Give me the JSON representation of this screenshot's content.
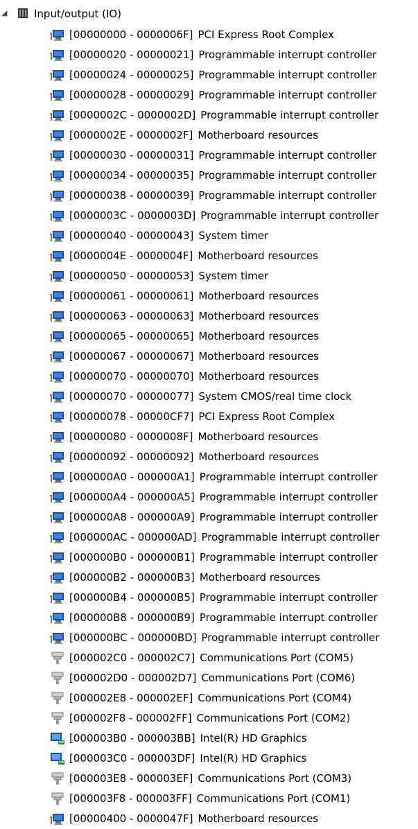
{
  "tree": {
    "root_label": "Input/output (IO)",
    "root_icon": "io-category-icon",
    "items": [
      {
        "range": "[00000000 - 0000006F]",
        "name": "PCI Express Root Complex",
        "icon": "system-device-icon"
      },
      {
        "range": "[00000020 - 00000021]",
        "name": "Programmable interrupt controller",
        "icon": "system-device-icon"
      },
      {
        "range": "[00000024 - 00000025]",
        "name": "Programmable interrupt controller",
        "icon": "system-device-icon"
      },
      {
        "range": "[00000028 - 00000029]",
        "name": "Programmable interrupt controller",
        "icon": "system-device-icon"
      },
      {
        "range": "[0000002C - 0000002D]",
        "name": "Programmable interrupt controller",
        "icon": "system-device-icon"
      },
      {
        "range": "[0000002E - 0000002F]",
        "name": "Motherboard resources",
        "icon": "system-device-icon"
      },
      {
        "range": "[00000030 - 00000031]",
        "name": "Programmable interrupt controller",
        "icon": "system-device-icon"
      },
      {
        "range": "[00000034 - 00000035]",
        "name": "Programmable interrupt controller",
        "icon": "system-device-icon"
      },
      {
        "range": "[00000038 - 00000039]",
        "name": "Programmable interrupt controller",
        "icon": "system-device-icon"
      },
      {
        "range": "[0000003C - 0000003D]",
        "name": "Programmable interrupt controller",
        "icon": "system-device-icon"
      },
      {
        "range": "[00000040 - 00000043]",
        "name": "System timer",
        "icon": "system-device-icon"
      },
      {
        "range": "[0000004E - 0000004F]",
        "name": "Motherboard resources",
        "icon": "system-device-icon"
      },
      {
        "range": "[00000050 - 00000053]",
        "name": "System timer",
        "icon": "system-device-icon"
      },
      {
        "range": "[00000061 - 00000061]",
        "name": "Motherboard resources",
        "icon": "system-device-icon"
      },
      {
        "range": "[00000063 - 00000063]",
        "name": "Motherboard resources",
        "icon": "system-device-icon"
      },
      {
        "range": "[00000065 - 00000065]",
        "name": "Motherboard resources",
        "icon": "system-device-icon"
      },
      {
        "range": "[00000067 - 00000067]",
        "name": "Motherboard resources",
        "icon": "system-device-icon"
      },
      {
        "range": "[00000070 - 00000070]",
        "name": "Motherboard resources",
        "icon": "system-device-icon"
      },
      {
        "range": "[00000070 - 00000077]",
        "name": "System CMOS/real time clock",
        "icon": "system-device-icon"
      },
      {
        "range": "[00000078 - 00000CF7]",
        "name": "PCI Express Root Complex",
        "icon": "system-device-icon"
      },
      {
        "range": "[00000080 - 0000008F]",
        "name": "Motherboard resources",
        "icon": "system-device-icon"
      },
      {
        "range": "[00000092 - 00000092]",
        "name": "Motherboard resources",
        "icon": "system-device-icon"
      },
      {
        "range": "[000000A0 - 000000A1]",
        "name": "Programmable interrupt controller",
        "icon": "system-device-icon"
      },
      {
        "range": "[000000A4 - 000000A5]",
        "name": "Programmable interrupt controller",
        "icon": "system-device-icon"
      },
      {
        "range": "[000000A8 - 000000A9]",
        "name": "Programmable interrupt controller",
        "icon": "system-device-icon"
      },
      {
        "range": "[000000AC - 000000AD]",
        "name": "Programmable interrupt controller",
        "icon": "system-device-icon"
      },
      {
        "range": "[000000B0 - 000000B1]",
        "name": "Programmable interrupt controller",
        "icon": "system-device-icon"
      },
      {
        "range": "[000000B2 - 000000B3]",
        "name": "Motherboard resources",
        "icon": "system-device-icon"
      },
      {
        "range": "[000000B4 - 000000B5]",
        "name": "Programmable interrupt controller",
        "icon": "system-device-icon"
      },
      {
        "range": "[000000B8 - 000000B9]",
        "name": "Programmable interrupt controller",
        "icon": "system-device-icon"
      },
      {
        "range": "[000000BC - 000000BD]",
        "name": "Programmable interrupt controller",
        "icon": "system-device-icon"
      },
      {
        "range": "[000002C0 - 000002C7]",
        "name": "Communications Port (COM5)",
        "icon": "port-connector-icon"
      },
      {
        "range": "[000002D0 - 000002D7]",
        "name": "Communications Port (COM6)",
        "icon": "port-connector-icon"
      },
      {
        "range": "[000002E8 - 000002EF]",
        "name": "Communications Port (COM4)",
        "icon": "port-connector-icon"
      },
      {
        "range": "[000002F8 - 000002FF]",
        "name": "Communications Port (COM2)",
        "icon": "port-connector-icon"
      },
      {
        "range": "[000003B0 - 000003BB]",
        "name": "Intel(R) HD Graphics",
        "icon": "display-adapter-icon"
      },
      {
        "range": "[000003C0 - 000003DF]",
        "name": "Intel(R) HD Graphics",
        "icon": "display-adapter-icon"
      },
      {
        "range": "[000003E8 - 000003EF]",
        "name": "Communications Port (COM3)",
        "icon": "port-connector-icon"
      },
      {
        "range": "[000003F8 - 000003FF]",
        "name": "Communications Port (COM1)",
        "icon": "port-connector-icon"
      },
      {
        "range": "[00000400 - 0000047F]",
        "name": "Motherboard resources",
        "icon": "system-device-icon"
      }
    ]
  }
}
